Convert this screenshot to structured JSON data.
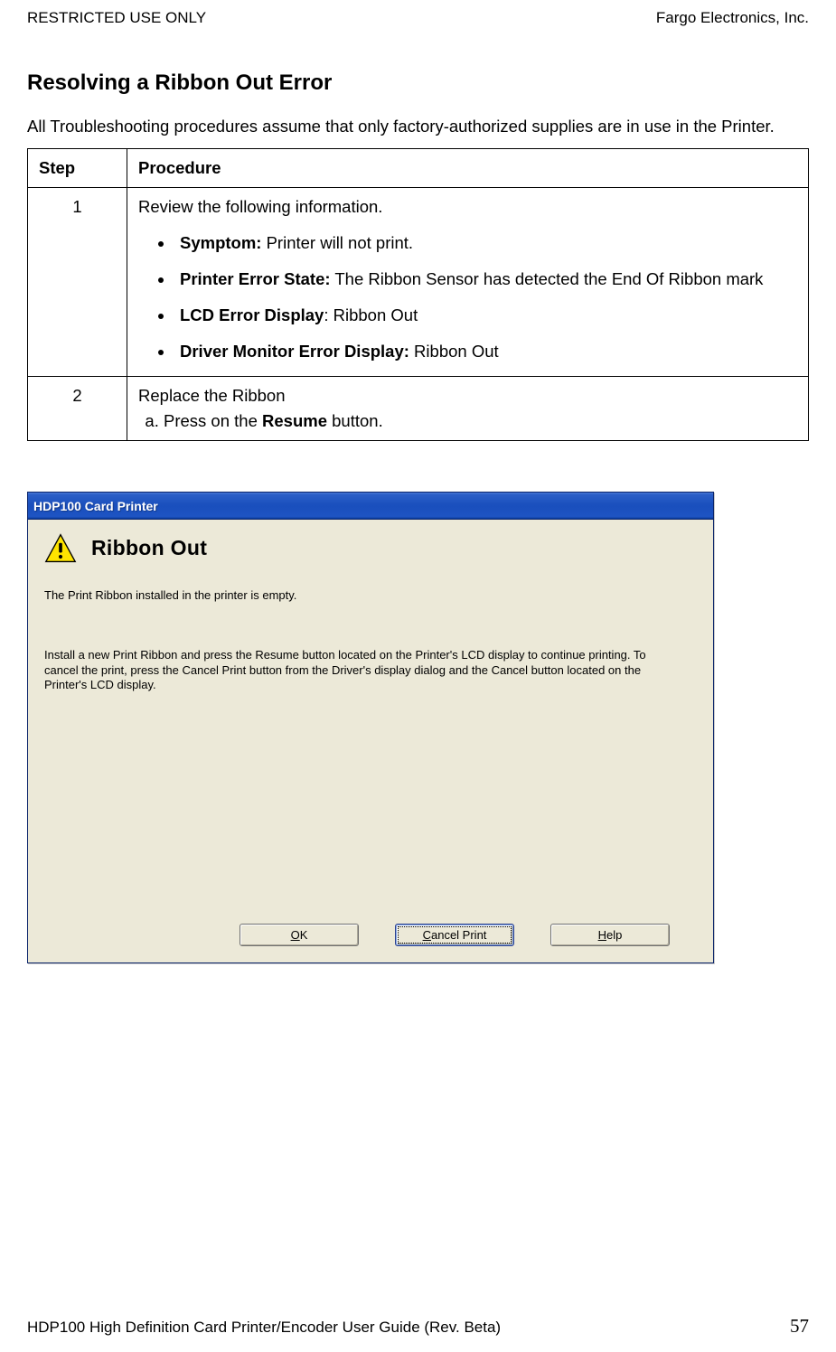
{
  "header": {
    "left": "RESTRICTED USE ONLY",
    "right": "Fargo Electronics, Inc."
  },
  "section_title": "Resolving a Ribbon Out Error",
  "intro": "All Troubleshooting procedures assume that only factory-authorized supplies are in use in the Printer.",
  "table": {
    "headers": {
      "step": "Step",
      "procedure": "Procedure"
    },
    "rows": [
      {
        "step": "1",
        "lead": "Review the following information.",
        "bullets": [
          {
            "label": "Symptom:",
            "text": " Printer will not print."
          },
          {
            "label": "Printer Error State:",
            "text": " The Ribbon Sensor has detected the End Of Ribbon mark"
          },
          {
            "label": "LCD Error Display",
            "after_label": ": Ribbon Out"
          },
          {
            "label": "Driver Monitor Error Display:",
            "text": " Ribbon Out"
          }
        ]
      },
      {
        "step": "2",
        "lead": "Replace the Ribbon",
        "substeps": [
          {
            "pre": "Press on the ",
            "bold": "Resume",
            "post": " button."
          }
        ]
      }
    ]
  },
  "dialog": {
    "title": "HDP100 Card Printer",
    "heading": "Ribbon Out",
    "message": "The Print Ribbon installed in the printer is empty.",
    "instruction": "Install a new Print Ribbon and press the Resume button located on the Printer's LCD display to continue printing. To cancel the print, press the Cancel Print button from the Driver's display dialog and the Cancel button located on the Printer's LCD display.",
    "buttons": {
      "ok": {
        "u": "O",
        "rest": "K"
      },
      "cancel": {
        "u": "C",
        "rest": "ancel Print"
      },
      "help": {
        "u": "H",
        "rest": "elp"
      }
    }
  },
  "footer": {
    "left": "HDP100 High Definition Card Printer/Encoder User Guide (Rev. Beta)",
    "page": "57"
  }
}
